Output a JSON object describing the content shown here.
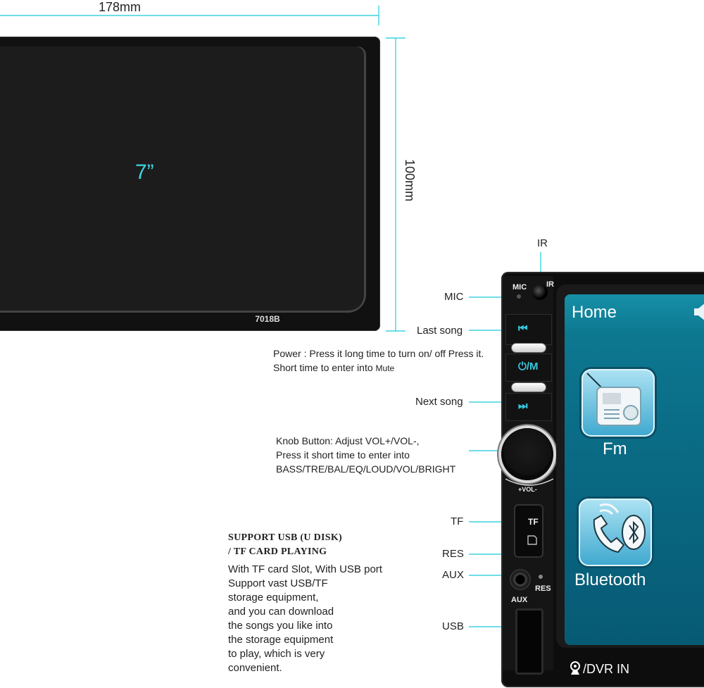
{
  "dimensions": {
    "width": "178mm",
    "height": "100mm",
    "diagonal": "7”"
  },
  "top_screen": {
    "model": "7018B"
  },
  "head_unit": {
    "mic_mark": "MIC",
    "ir_mark": "IR",
    "display": {
      "title": "Home",
      "apps": [
        {
          "label": "Fm",
          "icon": "radio-icon"
        },
        {
          "label": "Bluetooth",
          "icon": "bluetooth-phone-icon"
        }
      ],
      "footer": "/DVR IN"
    },
    "button_icons": {
      "prev": "⏮",
      "power": "⏻/M",
      "next": "⏭"
    },
    "knob_mark": "+VOL-",
    "tf_mark": "TF",
    "res_mark": "RES",
    "aux_mark": "AUX"
  },
  "callouts": {
    "ir": "IR",
    "mic": "MIC",
    "last_song": "Last song",
    "power_line1": "Power : Press it long time to turn on/ off Press it.",
    "power_line2_prefix": "Short time to enter into ",
    "power_line2_bold": "Mute",
    "next_song": "Next song",
    "knob_line1": "Knob Button: Adjust VOL+/VOL-,",
    "knob_line2": "Press it short time to enter into",
    "knob_line3": "BASS/TRE/BAL/EQ/LOUD/VOL/BRIGHT",
    "tf": "TF",
    "res": "RES",
    "aux": "AUX",
    "usb": "USB"
  },
  "support": {
    "heading_line1": "SUPPORT USB (U DISK)",
    "heading_line2": "/ TF CARD PLAYING",
    "body": [
      "With TF card Slot, With USB port",
      "Support vast USB/TF",
      "storage equipment,",
      "and you can download",
      "the songs you like into",
      "the storage equipment",
      "to play, which is very",
      "convenient."
    ]
  },
  "colors": {
    "accent": "#3fd3e0",
    "display": "#0a6c86",
    "unit": "#0d0d0d"
  }
}
